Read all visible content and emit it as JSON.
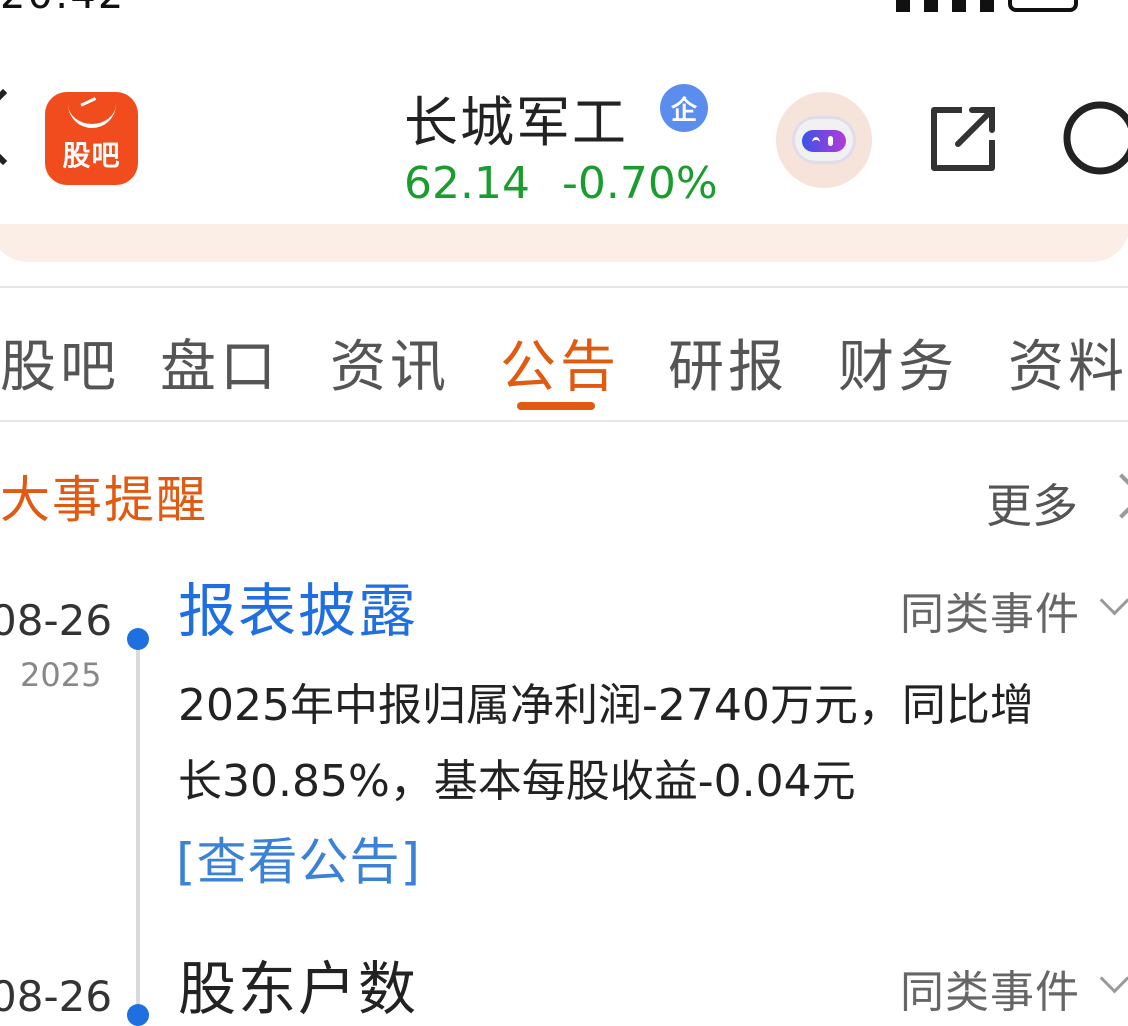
{
  "header": {
    "app_logo_label": "股吧",
    "stock_name": "长城军工",
    "corp_badge": "企",
    "price": "62.14",
    "change": "-0.70%"
  },
  "tabs": [
    {
      "label": "股吧",
      "active": false
    },
    {
      "label": "盘口",
      "active": false
    },
    {
      "label": "资讯",
      "active": false
    },
    {
      "label": "公告",
      "active": true
    },
    {
      "label": "研报",
      "active": false
    },
    {
      "label": "财务",
      "active": false
    },
    {
      "label": "资料",
      "active": false
    }
  ],
  "section": {
    "title": "大事提醒",
    "more_label": "更多"
  },
  "events": [
    {
      "date_md": "08-26",
      "year": "2025",
      "title": "报表披露",
      "similar_label": "同类事件",
      "description": "2025年中报归属净利润-2740万元，同比增长30.85%，基本每股收益-0.04元",
      "link_label": "[查看公告]"
    },
    {
      "date_md": "08-26",
      "title": "股东户数",
      "similar_label": "同类事件"
    }
  ],
  "colors": {
    "accent": "#e05a12",
    "price_down": "#1a9c2e",
    "link": "#3b82d6",
    "event_title": "#1f6fe0",
    "logo_bg": "#f04c1e"
  },
  "icons": [
    "back-icon",
    "app-logo",
    "corp-verified-icon",
    "robot-assistant-icon",
    "share-icon",
    "search-icon",
    "chevron-right-icon",
    "chevron-down-icon",
    "timeline-dot"
  ]
}
